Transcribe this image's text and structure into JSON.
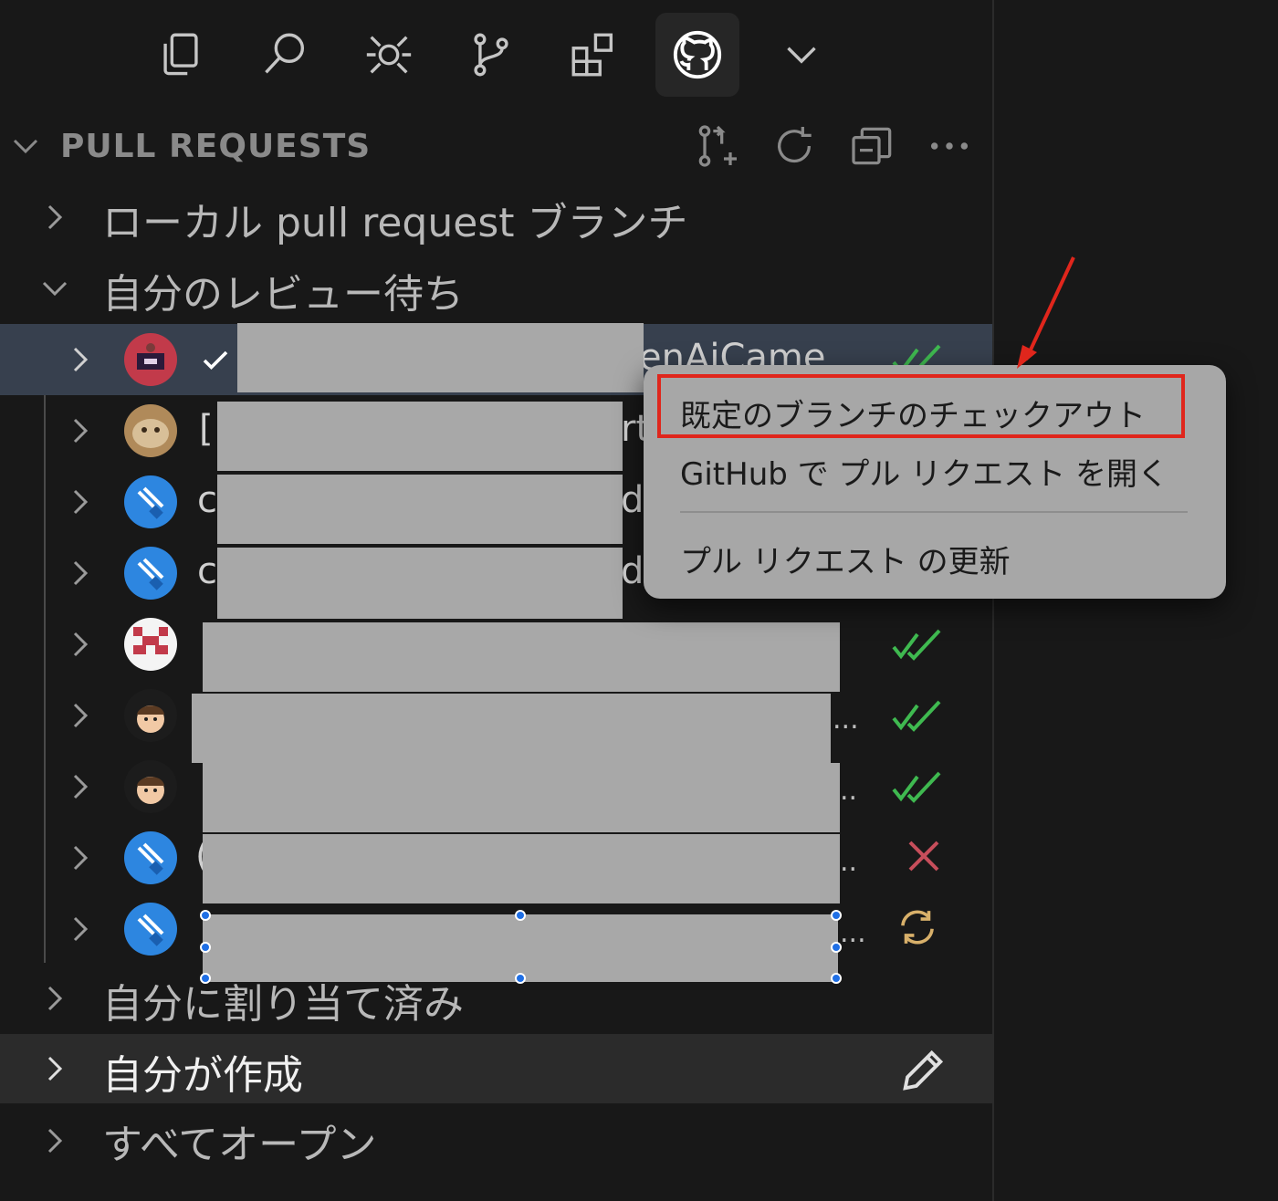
{
  "activity_bar": {
    "icons": [
      "explorer-icon",
      "search-icon",
      "debug-icon",
      "source-control-icon",
      "extensions-icon",
      "github-icon",
      "more-chevron-icon"
    ],
    "active": "github-icon"
  },
  "section": {
    "title": "PULL REQUESTS",
    "actions": [
      "create-pull-request-icon",
      "refresh-icon",
      "collapse-all-icon",
      "more-actions-icon"
    ]
  },
  "groups": {
    "local": "ローカル pull request ブランチ",
    "waiting": "自分のレビュー待ち",
    "assigned": "自分に割り当て済み",
    "created": "自分が作成",
    "all_open": "すべてオープン"
  },
  "pull_requests": [
    {
      "fragment": "enAiCame",
      "status": "approved"
    },
    {
      "fragment": "[",
      "fragment_right": "rt",
      "status": ""
    },
    {
      "fragment": "c",
      "fragment_right": "de",
      "status": ""
    },
    {
      "fragment": "c",
      "fragment_right": "de",
      "status": ""
    },
    {
      "fragment": "",
      "status": "approved"
    },
    {
      "fragment": "",
      "ellipsis": "...",
      "status": "approved"
    },
    {
      "fragment": "",
      "ellipsis": "..",
      "status": "approved"
    },
    {
      "fragment": "(",
      "ellipsis": "..",
      "status": "failed"
    },
    {
      "fragment": "",
      "ellipsis": "...",
      "status": "pending"
    }
  ],
  "context_menu": {
    "items": [
      "既定のブランチのチェックアウト",
      "GitHub で プル リクエスト を開く",
      "プル リクエスト の更新"
    ]
  },
  "colors": {
    "approved": "#3fb950",
    "failed": "#c74e5b",
    "pending": "#d8b06a",
    "annotation": "#e0261c"
  }
}
